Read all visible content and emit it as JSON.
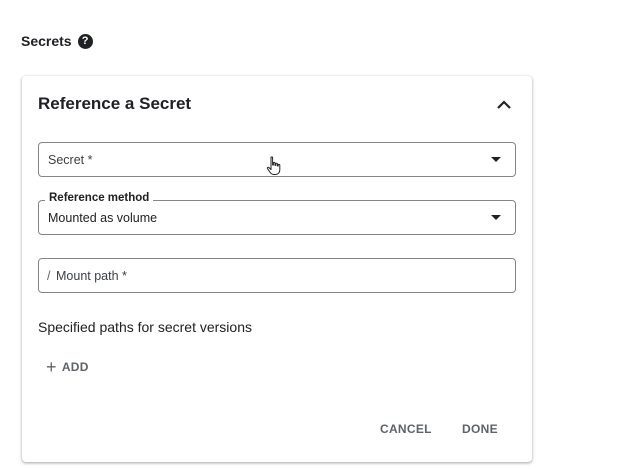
{
  "section": {
    "title": "Secrets",
    "help_icon": "?"
  },
  "card": {
    "title": "Reference a Secret",
    "collapse_icon": "chevron-up-icon",
    "secret_field": {
      "placeholder": "Secret *"
    },
    "reference_method": {
      "label": "Reference method",
      "value": "Mounted as volume"
    },
    "mount_path": {
      "prefix": "/",
      "placeholder": "Mount path *"
    },
    "paths_heading": "Specified paths for secret versions",
    "add_button": {
      "icon": "+",
      "label": "ADD"
    },
    "cancel_label": "CANCEL",
    "done_label": "DONE"
  },
  "colors": {
    "text": "#202124",
    "muted": "#5f6368",
    "border": "#80868b"
  }
}
